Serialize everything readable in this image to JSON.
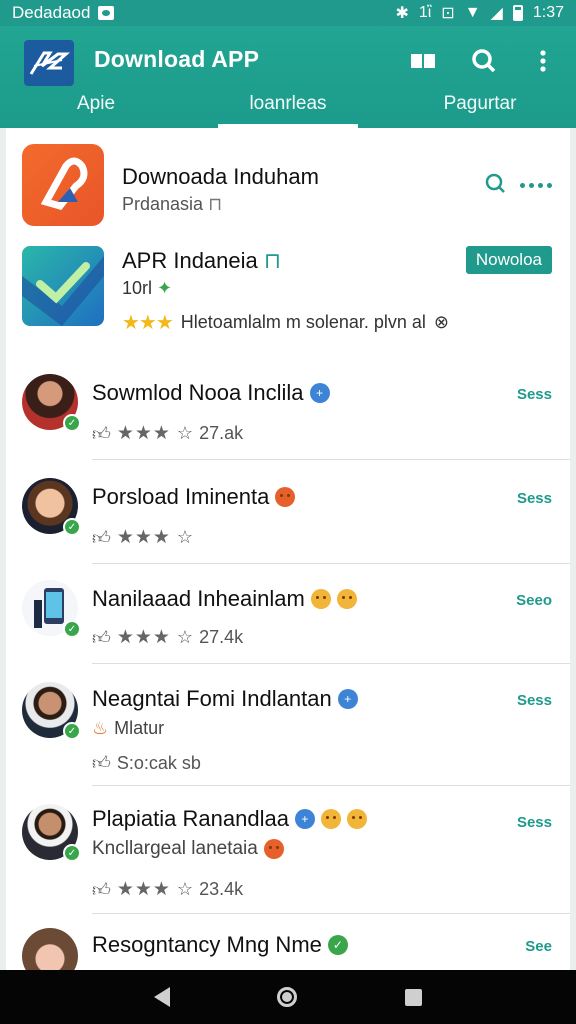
{
  "status_bar": {
    "carrier": "Dedadaod",
    "time": "1:37",
    "sig_text": "1ἲ"
  },
  "app": {
    "title": "Download APP"
  },
  "tabs": [
    {
      "label": "Apie",
      "active": false
    },
    {
      "label": "loanrleas",
      "active": true
    },
    {
      "label": "Pagurtar",
      "active": false
    }
  ],
  "colors": {
    "primary": "#1f9a8c",
    "star": "#f3b91a",
    "verified": "#3aa64c"
  },
  "top_item": {
    "name": "Downoada Induham",
    "subtitle": "Prdanasia",
    "sub_icon": "lock-icon"
  },
  "featured": {
    "title": "APR Indaneia",
    "downloads": "10rl",
    "rating_text": "Hletoamlalm m solenar. plvn al",
    "button": "Nowoloa"
  },
  "rows": [
    {
      "title": "Sowmlod Nooa Inclila",
      "title_icon": "plus-badge",
      "stars": "★★★",
      "count": "27.ak",
      "see": "Sess"
    },
    {
      "title": "Porsload Iminenta",
      "title_icon": "angry-emoji",
      "stars": "★★★",
      "count": "",
      "see": "Sess"
    },
    {
      "title": "Nanilaaad Inheainlam",
      "title_icon": "two-emoji",
      "stars": "★★★",
      "count": "27.4k",
      "see": "Seeo"
    },
    {
      "title": "Neagntai Fomi Indlantan",
      "title_icon": "plus-badge",
      "subline": "Mlatur",
      "meta_text": "S:o:cak sb",
      "see": "Sess"
    },
    {
      "title": "Plapiatia Ranandlaa",
      "title_icon": "plus-two-emoji",
      "subline": "Kncllargeal lanetaia",
      "stars": "★★★",
      "count": "23.4k",
      "see": "Sess"
    },
    {
      "title": "Resogntancy Mng Nme",
      "title_icon": "check-badge",
      "see": "See"
    }
  ]
}
